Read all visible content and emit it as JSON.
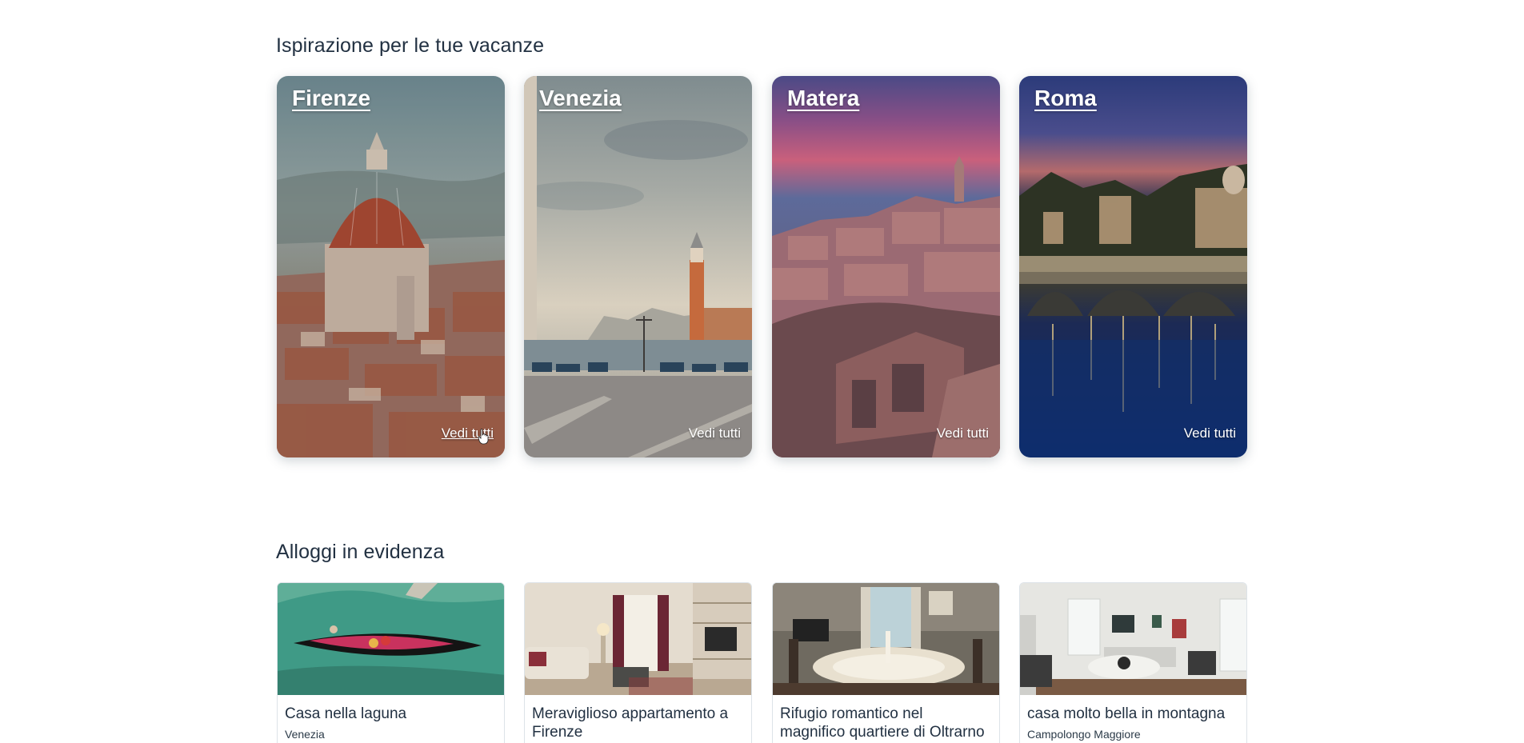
{
  "inspiration": {
    "title": "Ispirazione per le tue vacanze",
    "destinations": [
      {
        "name": "Firenze",
        "see_all": "Vedi tutti"
      },
      {
        "name": "Venezia",
        "see_all": "Vedi tutti"
      },
      {
        "name": "Matera",
        "see_all": "Vedi tutti"
      },
      {
        "name": "Roma",
        "see_all": "Vedi tutti"
      }
    ]
  },
  "featured": {
    "title": "Alloggi in evidenza",
    "listings": [
      {
        "title": "Casa nella laguna",
        "place": "Venezia"
      },
      {
        "title": "Meraviglioso appartamento a Firenze",
        "place": ""
      },
      {
        "title": "Rifugio romantico nel magnifico quartiere di Oltrarno a Fi...",
        "place": ""
      },
      {
        "title": "casa molto bella in montagna",
        "place": "Campolongo Maggiore"
      }
    ]
  }
}
